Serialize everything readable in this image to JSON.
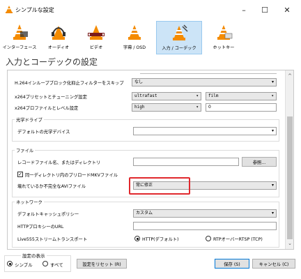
{
  "window": {
    "title": "シンプルな設定",
    "minimize": "–",
    "maximize": "☐",
    "close": "✕"
  },
  "toolbar": [
    {
      "label": "インターフェース",
      "icon": "vlc-cone-interface-icon"
    },
    {
      "label": "オーディオ",
      "icon": "vlc-cone-headphones-icon"
    },
    {
      "label": "ビデオ",
      "icon": "vlc-cone-video-icon"
    },
    {
      "label": "字幕 / OSD",
      "icon": "vlc-cone-subtitles-icon"
    },
    {
      "label": "入力 / コーデック",
      "icon": "vlc-cone-input-icon"
    },
    {
      "label": "ホットキー",
      "icon": "vlc-cone-hotkeys-icon"
    }
  ],
  "section_title": "入力とコーデックの設定",
  "settings": {
    "h264_filter_label": "H.264インループブロック化抑止フィルターをスキップ",
    "h264_filter_value": "なし",
    "x264_preset_label": "x264プリセットとチューニング設定",
    "x264_preset_value": "ultrafast",
    "x264_tune_value": "film",
    "x264_profile_label": "x264プロファイルとレベル設定",
    "x264_profile_value": "high",
    "x264_level_value": "0"
  },
  "optical": {
    "title": "光学ドライブ",
    "device_label": "デフォルトの光学デバイス",
    "device_value": ""
  },
  "file": {
    "title": "ファイル",
    "record_label": "レコードファイル名、またはディレクトリ",
    "record_value": "",
    "browse_label": "参照...",
    "preload_label": "同一ディレクトリ内のプリロードMKVファイル",
    "preload_checked": true,
    "avi_label": "壊れているか不完全なAVIファイル",
    "avi_value": "常に修正"
  },
  "network": {
    "title": "ネットワーク",
    "cache_label": "デフォルトキャッシュポリシー",
    "cache_value": "カスタム",
    "proxy_label": "HTTPプロキシーのURL",
    "proxy_value": "",
    "live555_label": "Live555ストリームトランスポート",
    "live555_opt1": "HTTP(デフォルト)",
    "live555_opt2": "RTPオーバーRTSP (TCP)",
    "live555_selected": "HTTP(デフォルト)"
  },
  "footer": {
    "display_title": "設定の表示",
    "simple_label": "シンプル",
    "all_label": "すべて",
    "display_selected": "シンプル",
    "reset_label": "設定をリセット (R)",
    "save_label": "保存 (S)",
    "cancel_label": "キャンセル (C)"
  },
  "colors": {
    "accent_selected": "#cce4f7",
    "highlight_box": "#e0282d",
    "vlc_orange": "#f48b00"
  }
}
